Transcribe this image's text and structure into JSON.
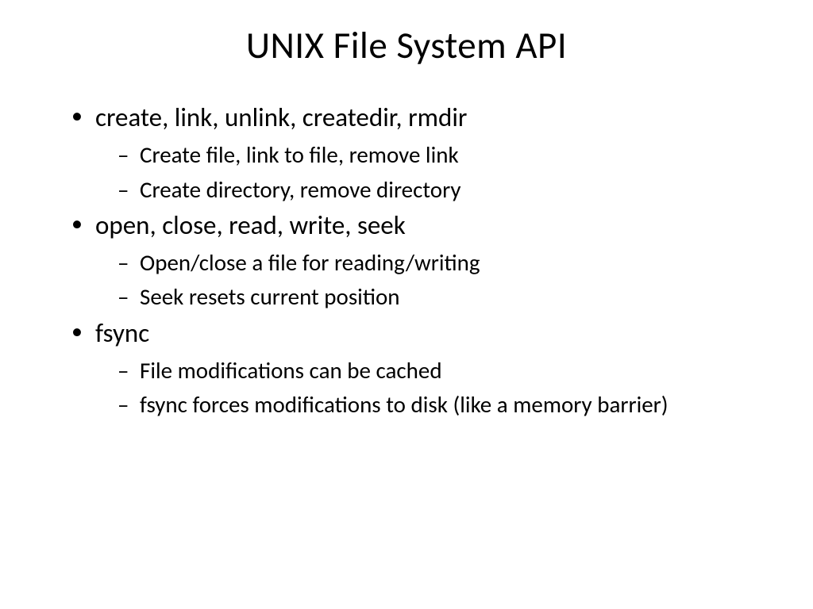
{
  "title": "UNIX File System API",
  "bullets": [
    {
      "text": "create, link, unlink, createdir, rmdir",
      "sub": [
        "Create file, link to file, remove link",
        "Create directory, remove directory"
      ]
    },
    {
      "text": "open, close, read, write, seek",
      "sub": [
        "Open/close a file for reading/writing",
        "Seek resets current position"
      ]
    },
    {
      "text": "fsync",
      "sub": [
        "File modifications can be cached",
        "fsync forces modifications to disk (like a memory barrier)"
      ]
    }
  ]
}
